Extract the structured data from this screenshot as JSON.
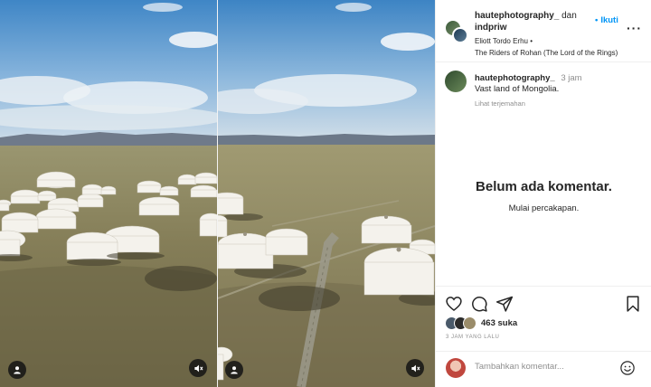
{
  "post": {
    "author": "hautephotography_",
    "conjunction": "dan",
    "collaborator": "indpriw",
    "follow_label": "Ikuti",
    "follow_dot": "•",
    "more_label": "···",
    "audio_artist": "Eliott Tordo Erhu",
    "audio_separator": "•",
    "audio_title": "The Riders of Rohan (The Lord of the Rings)"
  },
  "caption": {
    "username": "hautephotography_",
    "time": "3 jam",
    "text": "Vast land of Mongolia.",
    "see_translation": "Lihat terjemahan"
  },
  "comments": {
    "empty_title": "Belum ada komentar.",
    "empty_subtitle": "Mulai percakapan."
  },
  "actions": {
    "icons": [
      "heart-icon",
      "comment-icon",
      "share-icon",
      "bookmark-icon"
    ],
    "likes": "463 suka",
    "time_ago": "3 JAM YANG LALU"
  },
  "comment_input": {
    "placeholder": "Tambahkan komentar..."
  },
  "media": {
    "controls": [
      "tagged-user-icon",
      "mute-icon"
    ]
  },
  "colors": {
    "accent": "#0095f6",
    "text": "#262626",
    "secondary": "#8e8e8e",
    "border": "#efefef"
  }
}
